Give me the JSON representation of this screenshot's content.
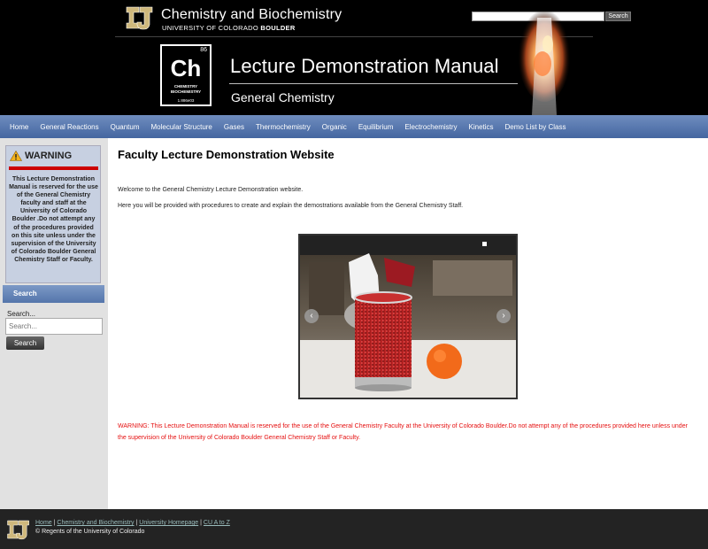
{
  "header": {
    "dept_name": "Chemistry and Biochemistry",
    "dept_sub_a": "UNIVERSITY OF COLORADO ",
    "dept_sub_b": "BOULDER",
    "search_button": "Search",
    "element_box": {
      "number": "86",
      "symbol": "Ch",
      "label_1": "CHEMISTRY",
      "label_2": "BIOCHEMISTRY",
      "mass": "1.886e03"
    },
    "manual_title": "Lecture Demonstration Manual",
    "manual_sub": "General Chemistry"
  },
  "nav": {
    "items": [
      "Home",
      "General Reactions",
      "Quantum",
      "Molecular Structure",
      "Gases",
      "Thermochemistry",
      "Organic",
      "Equilibrium",
      "Electrochemistry",
      "Kinetics",
      "Demo List by Class"
    ]
  },
  "sidebar": {
    "warning_title": "WARNING",
    "warning_text": "This Lecture Demonstration Manual is reserved for the use of the General Chemistry faculty and staff at the University of Colorado Boulder .Do not attempt any of the procedures provided on this site unless under the supervision of the University of Colorado Boulder General Chemistry Staff or Faculty.",
    "search_heading": "Search",
    "search_label": "Search...",
    "search_placeholder": "Search...",
    "search_button": "Search"
  },
  "main": {
    "title": "Faculty Lecture Demonstration Website",
    "welcome": "Welcome to the General Chemistry Lecture Demonstration website.",
    "here": "Here you will be provided with procedures to create and explain the demostrations available from the General Chemistry Staff.",
    "prev_glyph": "‹",
    "next_glyph": "›",
    "warning": "WARNING: This Lecture Demonstration Manual is reserved for the use of the General Chemistry Faculty at the University of Colorado Boulder.Do not attempt any of the procedures provided here unless under the supervision of the University of Colorado Boulder General Chemistry Staff or Faculty."
  },
  "footer": {
    "link_home": "Home",
    "link_chem": "Chemistry and Biochemistry",
    "link_univ": "University Homepage",
    "link_atoz": "CU A to Z",
    "sep": " | ",
    "copyright": "© Regents of the University of Colorado"
  },
  "colors": {
    "nav_top": "#6f8dbf",
    "nav_bottom": "#4466a0",
    "warning_red": "#e51010",
    "cu_gold": "#cfb87c"
  },
  "icons": {
    "cu_logo": "cu-logo",
    "warning": "warning-triangle-icon",
    "prev": "chevron-left-icon",
    "next": "chevron-right-icon"
  }
}
